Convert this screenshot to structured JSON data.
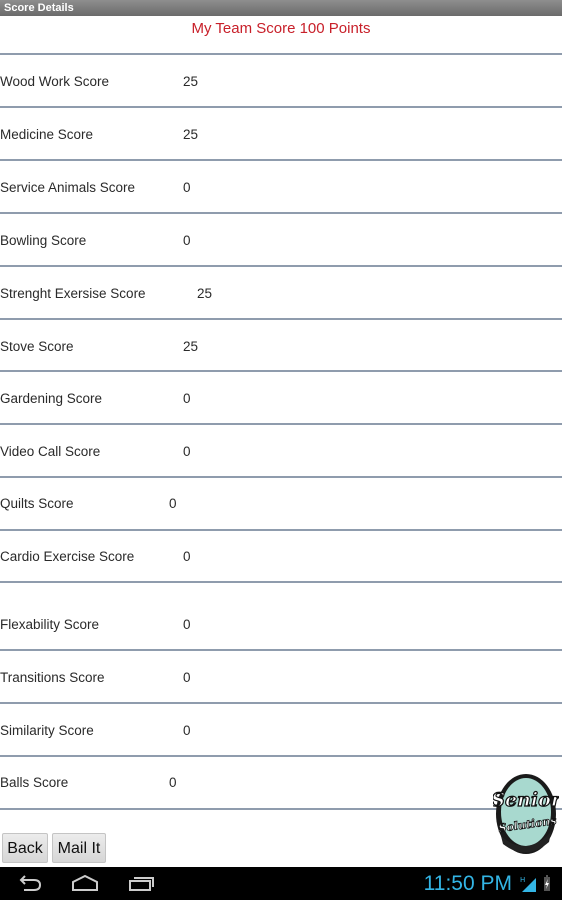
{
  "window": {
    "title": "Score Details"
  },
  "header": {
    "team_score_text": "My Team Score 100  Points"
  },
  "scores": [
    {
      "label": "Wood Work Score",
      "value": "25"
    },
    {
      "label": "Medicine Score",
      "value": "25"
    },
    {
      "label": "Service Animals Score",
      "value": "0"
    },
    {
      "label": "Bowling Score",
      "value": "0"
    },
    {
      "label": "Strenght Exersise Score",
      "value": "25"
    },
    {
      "label": "Stove Score",
      "value": "25"
    },
    {
      "label": "Gardening Score",
      "value": "0"
    },
    {
      "label": "Video Call Score",
      "value": "0"
    },
    {
      "label": "Quilts Score",
      "value": "0"
    },
    {
      "label": "Cardio Exercise Score",
      "value": "0"
    },
    {
      "label": "Flexability Score",
      "value": "0"
    },
    {
      "label": "Transitions Score",
      "value": "0"
    },
    {
      "label": "Similarity Score",
      "value": "0"
    },
    {
      "label": "Balls Score",
      "value": "0"
    }
  ],
  "buttons": {
    "back": "Back",
    "mail": "Mail It"
  },
  "logo": {
    "line1": "Senior",
    "line2": "Solutions"
  },
  "status_bar": {
    "time": "11:50 PM",
    "network": "H"
  },
  "colors": {
    "title_red": "#c8202a",
    "clock_blue": "#33b5e5",
    "divider": "#8f9cad"
  }
}
